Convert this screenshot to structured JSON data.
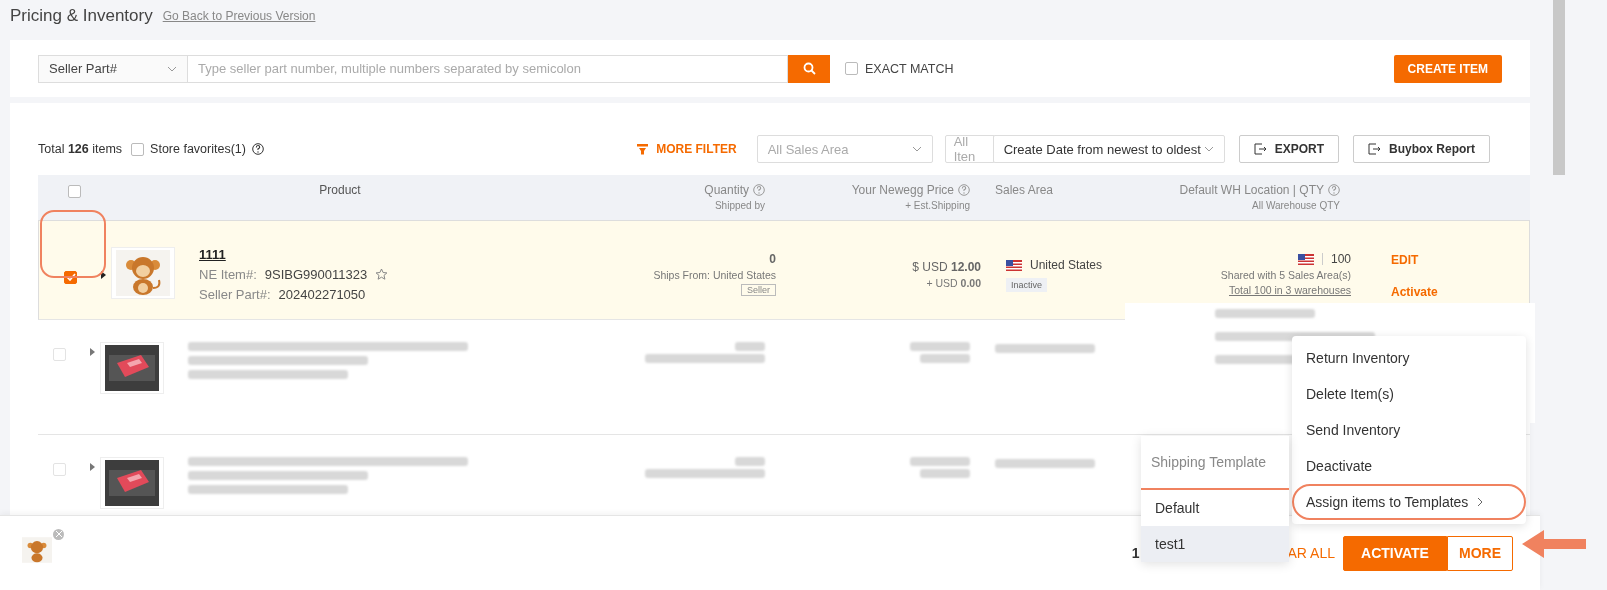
{
  "page": {
    "title": "Pricing & Inventory",
    "back_link": "Go Back to Previous Version"
  },
  "search": {
    "field_select": "Seller Part#",
    "placeholder": "Type seller part number, multiple numbers separated by semicolon",
    "exact_match": {
      "label": "EXACT MATCH",
      "checked": false
    },
    "create_button": "CREATE ITEM"
  },
  "toolbar": {
    "total": "Total **126** items",
    "store_favorites": {
      "label": "Store favorites(1)",
      "checked": false
    },
    "more_filter": "MORE FILTER",
    "sales_area_placeholder": "All Sales Area",
    "items_filter": "All Iten",
    "sort": "Create Date from newest to oldest",
    "export": "EXPORT",
    "buybox": "Buybox Report"
  },
  "table": {
    "header_checked": false,
    "columns": [
      {
        "title": "Product"
      },
      {
        "title": "Quantity",
        "subtitle": "Shipped by",
        "help": true
      },
      {
        "title": "Your Newegg Price",
        "subtitle": "+ Est.Shipping",
        "help": true
      },
      {
        "title": "Sales Area"
      },
      {
        "title": "Default WH Location | QTY",
        "subtitle": "All Warehouse QTY",
        "help": true
      }
    ],
    "rows": [
      {
        "kind": "clear",
        "selected": true,
        "checked": true,
        "annotated": true,
        "name": "1111",
        "ne_item_label": "NE Item#:",
        "ne_item": "9SIBG990011323",
        "seller_part_label": "Seller Part#:",
        "seller_part": "202402271050",
        "quantity": "0",
        "ships_from": "Ships From: United States",
        "shipped_by": "Seller",
        "price": "$ USD **12.00**",
        "shipping": "+ USD **0.00**",
        "sales_area": "United States",
        "status": "Inactive",
        "wh_qty": "100",
        "shared": "Shared with 5 Sales Area(s)",
        "total_wh": "Total 100 in 3 warehouses",
        "actions": [
          "EDIT",
          "Activate"
        ]
      },
      {
        "kind": "blurred",
        "selected": false,
        "checked": false
      },
      {
        "kind": "blurred",
        "selected": false,
        "checked": false
      }
    ]
  },
  "bottom_bar": {
    "count": "1",
    "clear_all": "AR ALL",
    "activate": "ACTIVATE",
    "more": "MORE",
    "more_annotated": true
  },
  "more_menu": {
    "items": [
      {
        "label": "Return Inventory",
        "submenu": false,
        "annotated": false
      },
      {
        "label": "Delete Item(s)",
        "submenu": false,
        "annotated": false
      },
      {
        "label": "Send Inventory",
        "submenu": false,
        "annotated": false
      },
      {
        "label": "Deactivate",
        "submenu": false,
        "annotated": false
      },
      {
        "label": "Assign items to Templates",
        "submenu": true,
        "annotated": true
      }
    ]
  },
  "submenu": {
    "title": "Shipping Template",
    "items": [
      {
        "label": "Default",
        "selected": false
      },
      {
        "label": "test1",
        "selected": true
      }
    ]
  }
}
